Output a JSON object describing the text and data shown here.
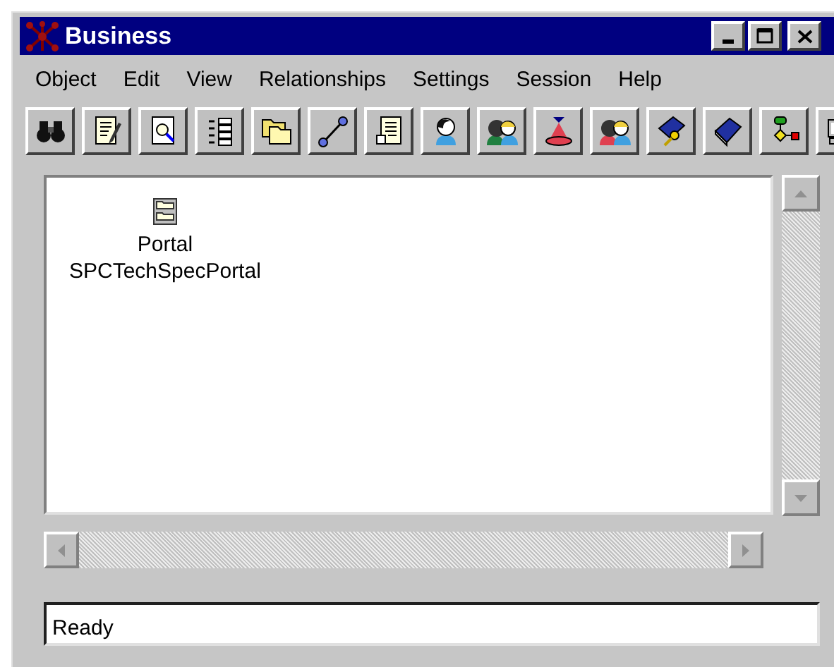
{
  "window": {
    "title": "Business"
  },
  "menu": [
    "Object",
    "Edit",
    "View",
    "Relationships",
    "Settings",
    "Session",
    "Help"
  ],
  "objects": [
    {
      "type_label": "Portal",
      "name": "SPCTechSpecPortal"
    }
  ],
  "status_bar": {
    "text": "Ready"
  }
}
